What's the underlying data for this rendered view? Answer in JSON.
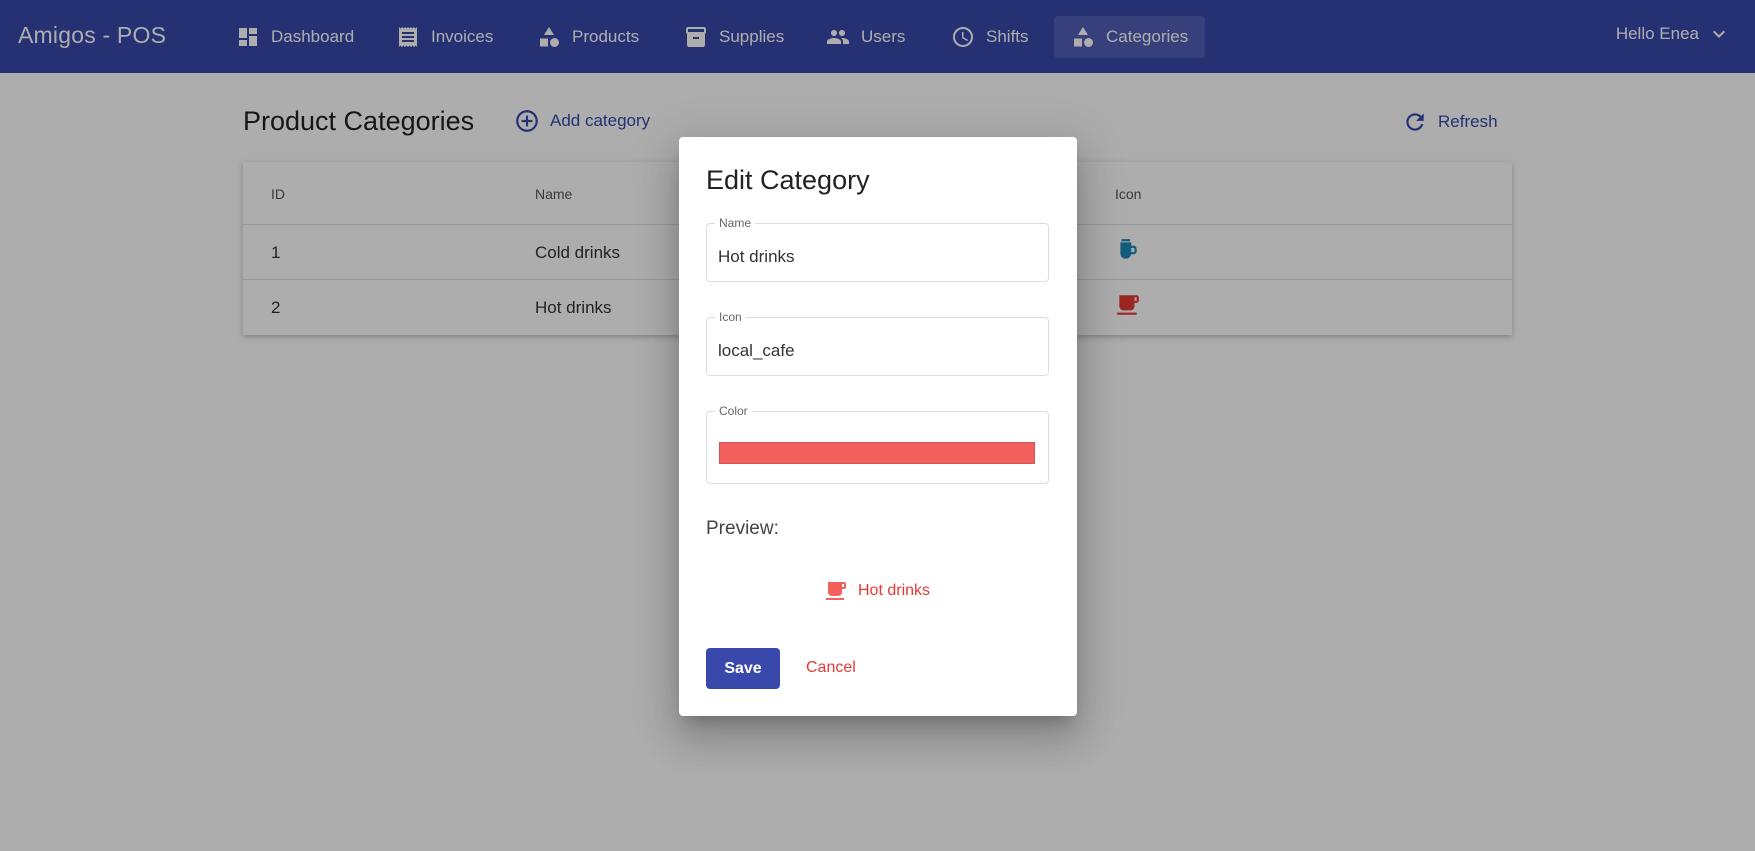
{
  "app": {
    "title": "Amigos - POS"
  },
  "nav": {
    "items": [
      {
        "label": "Dashboard",
        "icon": "dashboard-icon"
      },
      {
        "label": "Invoices",
        "icon": "receipt-icon"
      },
      {
        "label": "Products",
        "icon": "shapes-icon"
      },
      {
        "label": "Supplies",
        "icon": "archive-icon"
      },
      {
        "label": "Users",
        "icon": "people-icon"
      },
      {
        "label": "Shifts",
        "icon": "clock-icon"
      },
      {
        "label": "Categories",
        "icon": "shapes-icon",
        "active": true
      }
    ],
    "user_greeting": "Hello Enea"
  },
  "page": {
    "title": "Product Categories",
    "add_label": "Add category",
    "refresh_label": "Refresh"
  },
  "table": {
    "headers": {
      "id": "ID",
      "name": "Name",
      "icon": "Icon"
    },
    "rows": [
      {
        "id": "1",
        "name": "Cold drinks",
        "icon": "local_drink",
        "color": "#1e88b5"
      },
      {
        "id": "2",
        "name": "Hot drinks",
        "icon": "local_cafe",
        "color": "#e53935"
      }
    ]
  },
  "dialog": {
    "title": "Edit Category",
    "name_label": "Name",
    "name_value": "Hot drinks",
    "icon_label": "Icon",
    "icon_value": "local_cafe",
    "color_label": "Color",
    "color_value": "#f25f5c",
    "preview_label": "Preview:",
    "preview_text": "Hot drinks",
    "save_label": "Save",
    "cancel_label": "Cancel"
  },
  "colors": {
    "primary": "#3949ab",
    "danger": "#e53935",
    "cold": "#1e88b5"
  }
}
